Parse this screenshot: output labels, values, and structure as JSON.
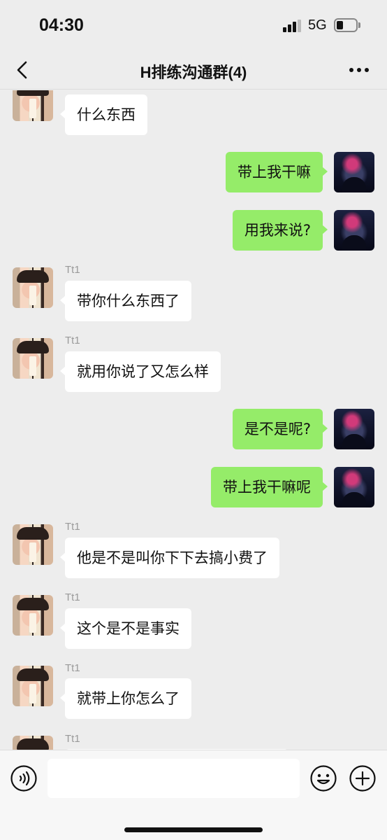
{
  "status_bar": {
    "time": "04:30",
    "network": "5G",
    "signal_bars": 3,
    "battery_level": 0.35
  },
  "nav": {
    "title": "H排练沟通群(4)",
    "back_icon": "chevron-left-icon",
    "more_icon": "more-dots-icon"
  },
  "messages": [
    {
      "side": "in",
      "sender": "",
      "text": "什么东西"
    },
    {
      "side": "out",
      "text": "带上我干嘛"
    },
    {
      "side": "out",
      "text": "用我来说?"
    },
    {
      "side": "in",
      "sender": "Tt1",
      "text": "带你什么东西了"
    },
    {
      "side": "in",
      "sender": "Tt1",
      "text": "就用你说了又怎么样"
    },
    {
      "side": "out",
      "text": "是不是呢?"
    },
    {
      "side": "out",
      "text": "带上我干嘛呢"
    },
    {
      "side": "in",
      "sender": "Tt1",
      "text": "他是不是叫你下下去搞小费了"
    },
    {
      "side": "in",
      "sender": "Tt1",
      "text": "这个是不是事实"
    },
    {
      "side": "in",
      "sender": "Tt1",
      "text": "就带上你怎么了"
    },
    {
      "side": "in",
      "sender": "Tt1",
      "text": ""
    }
  ],
  "input_bar": {
    "voice_icon": "voice-icon",
    "emoji_icon": "emoji-icon",
    "plus_icon": "plus-circle-icon",
    "input_value": ""
  },
  "colors": {
    "background": "#ededed",
    "bubble_in": "#ffffff",
    "bubble_out": "#95ec69",
    "sender_name": "#9a9a9a"
  }
}
